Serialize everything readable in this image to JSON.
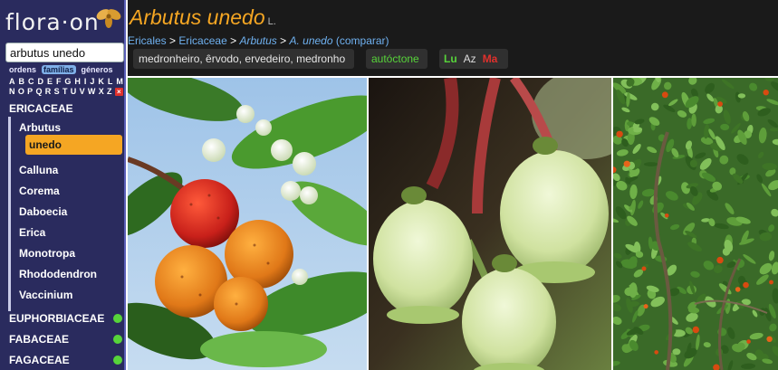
{
  "logo": {
    "text": "flora·on"
  },
  "search": {
    "value": "arbutus unedo"
  },
  "rank_tabs": [
    {
      "label": "ordens",
      "active": false
    },
    {
      "label": "famílias",
      "active": true
    },
    {
      "label": "géneros",
      "active": false
    }
  ],
  "alphabet": {
    "row1": [
      "A",
      "B",
      "C",
      "D",
      "E",
      "F",
      "G",
      "H",
      "I",
      "J",
      "K",
      "L",
      "M"
    ],
    "row2": [
      "N",
      "O",
      "P",
      "Q",
      "R",
      "S",
      "T",
      "U",
      "V",
      "W",
      "X",
      "Z"
    ],
    "clear": "×"
  },
  "tree": {
    "family_selected": "ERICACEAE",
    "genera": [
      "Arbutus",
      "Calluna",
      "Corema",
      "Daboecia",
      "Erica",
      "Monotropa",
      "Rhododendron",
      "Vaccinium"
    ],
    "species_selected": "unedo",
    "other_families": [
      "EUPHORBIACEAE",
      "FABACEAE",
      "FAGACEAE"
    ]
  },
  "header": {
    "title": "Arbutus unedo",
    "author": "L.",
    "breadcrumb": {
      "order": "Ericales",
      "family": "Ericaceae",
      "genus": "Arbutus",
      "species": "A. unedo",
      "compare": "(comparar)",
      "sep": " > "
    },
    "common_names": "medronheiro, êrvodo, ervedeiro, medronho",
    "native_status": "autóctone",
    "regions": {
      "lu": "Lu",
      "az": "Az",
      "ma": "Ma"
    }
  },
  "colors": {
    "sidebar_bg": "#2a2b5e",
    "header_bg": "#1a1a1a",
    "accent": "#f5a623",
    "link": "#6fb1f0",
    "native_green": "#57d43a",
    "absent_red": "#e0302c"
  },
  "icons": {
    "logo_flower": "flower-icon",
    "status_dot": "green-dot-icon"
  }
}
